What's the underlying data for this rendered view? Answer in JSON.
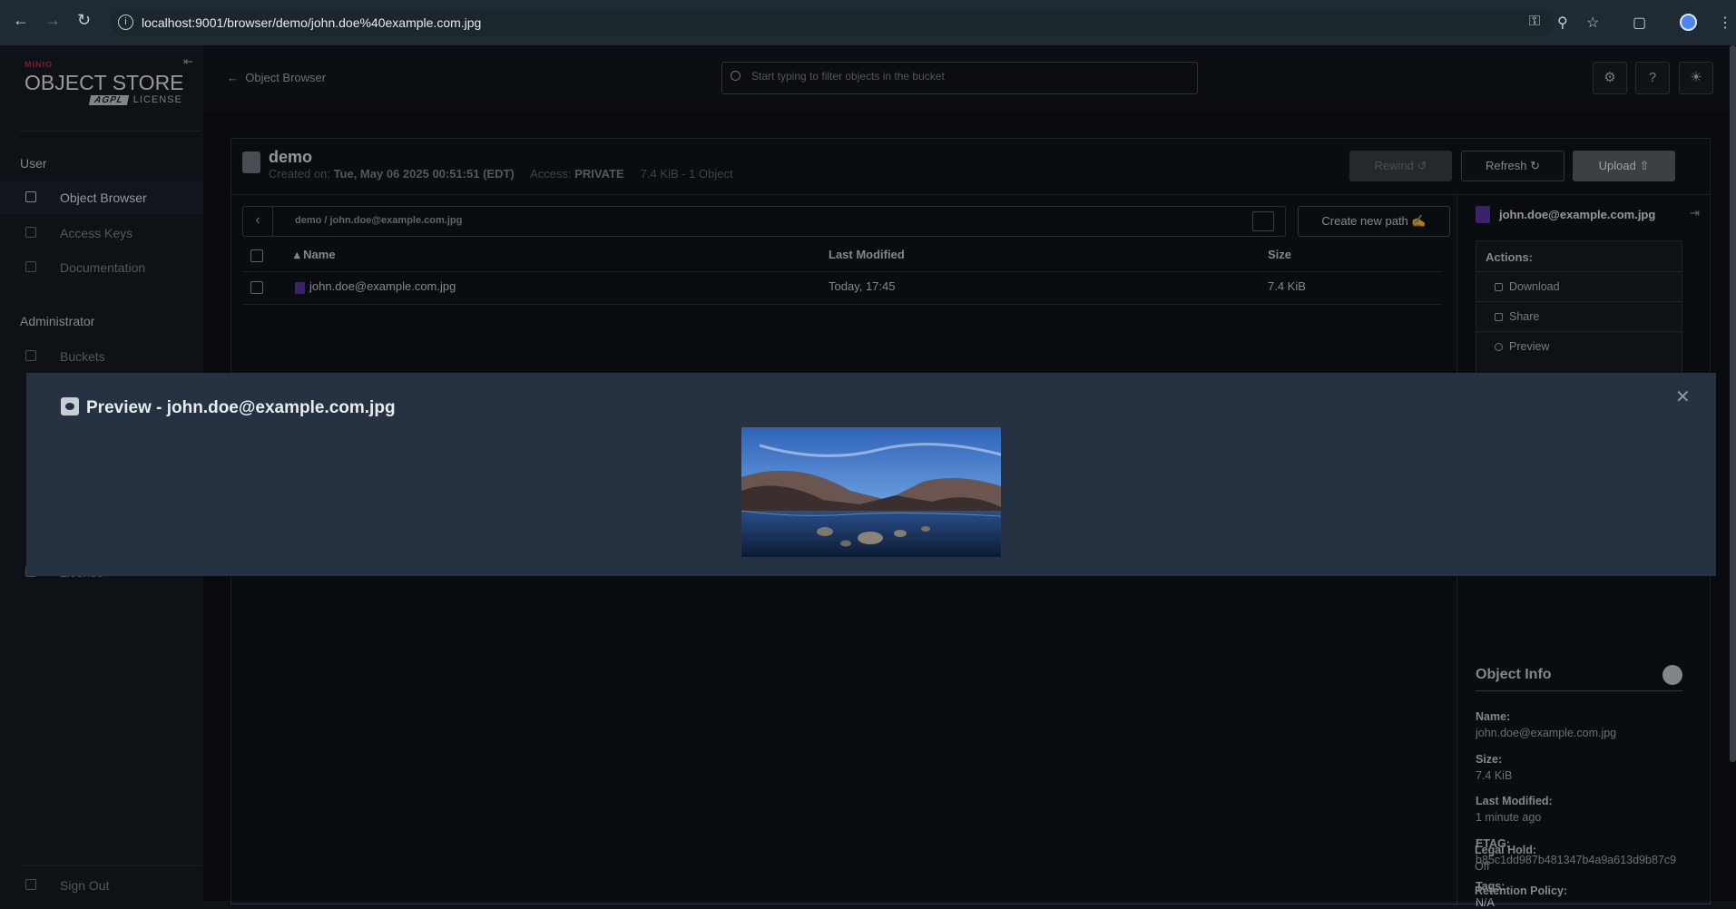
{
  "browser": {
    "url": "localhost:9001/browser/demo/john.doe%40example.com.jpg"
  },
  "sidebar": {
    "logo_top": "MINIO",
    "logo_main": "OBJECT STORE",
    "logo_agpl": "AGPL",
    "logo_license": "LICENSE",
    "section_user": "User",
    "items_user": [
      {
        "label": "Object Browser",
        "icon": "folder-icon",
        "active": true
      },
      {
        "label": "Access Keys",
        "icon": "key-icon"
      },
      {
        "label": "Documentation",
        "icon": "doc-icon"
      }
    ],
    "section_admin": "Administrator",
    "items_admin": [
      {
        "label": "Buckets",
        "icon": "bucket-icon"
      }
    ],
    "license_item": "License",
    "sign_out": "Sign Out"
  },
  "topbar": {
    "back_label": "Object Browser",
    "filter_placeholder": "Start typing to filter objects in the bucket"
  },
  "bucket": {
    "name": "demo",
    "created_label": "Created on:",
    "created_value": "Tue, May 06 2025 00:51:51 (EDT)",
    "access_label": "Access:",
    "access_value": "PRIVATE",
    "summary": "7.4 KiB - 1 Object",
    "rewind_label": "Rewind",
    "refresh_label": "Refresh",
    "upload_label": "Upload"
  },
  "breadcrumb": {
    "path": "demo / john.doe@example.com.jpg",
    "create_path_label": "Create new path"
  },
  "table": {
    "headers": {
      "name": "Name",
      "modified": "Last Modified",
      "size": "Size"
    },
    "rows": [
      {
        "name": "john.doe@example.com.jpg",
        "modified": "Today, 17:45",
        "size": "7.4 KiB"
      }
    ]
  },
  "details": {
    "file_name": "john.doe@example.com.jpg",
    "actions_header": "Actions:",
    "actions": [
      "Download",
      "Share",
      "Preview"
    ],
    "object_info_title": "Object Info",
    "info": [
      {
        "k": "Name:",
        "v": "john.doe@example.com.jpg"
      },
      {
        "k": "Size:",
        "v": "7.4 KiB"
      },
      {
        "k": "Last Modified:",
        "v": "1 minute ago"
      },
      {
        "k": "ETAG:",
        "v": "b85c1dd987b481347b4a9a613d9b87c9"
      },
      {
        "k": "Tags:",
        "v": "N/A"
      },
      {
        "k": "Legal Hold:",
        "v": "Off"
      },
      {
        "k": "Retention Policy:",
        "v": ""
      }
    ]
  },
  "modal": {
    "title": "Preview - john.doe@example.com.jpg"
  },
  "colors": {
    "accent_file": "#5b35a8",
    "brand_red": "#c72c48"
  }
}
